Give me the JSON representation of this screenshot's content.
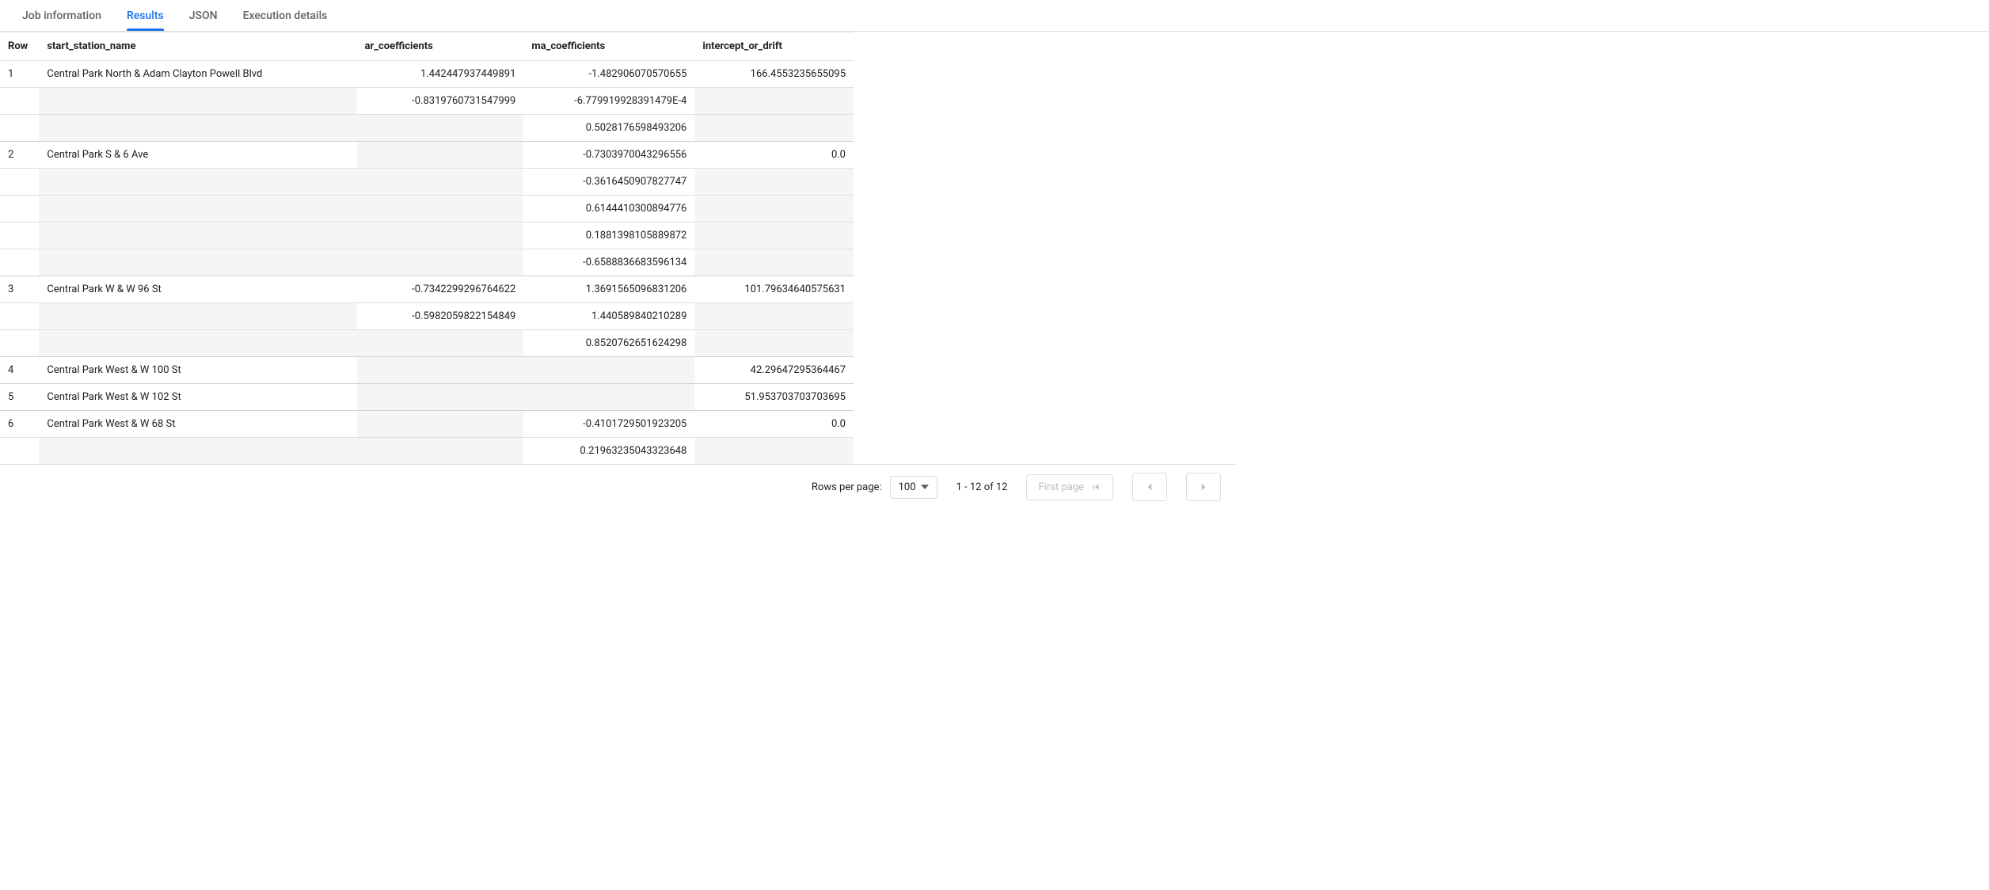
{
  "tabs": {
    "items": [
      {
        "label": "Job information",
        "active": false
      },
      {
        "label": "Results",
        "active": true
      },
      {
        "label": "JSON",
        "active": false
      },
      {
        "label": "Execution details",
        "active": false
      }
    ]
  },
  "table": {
    "headers": {
      "row": "Row",
      "name": "start_station_name",
      "ar": "ar_coefficients",
      "ma": "ma_coefficients",
      "intercept": "intercept_or_drift"
    },
    "groups": [
      {
        "row": "1",
        "name": "Central Park North & Adam Clayton Powell Blvd",
        "intercept": "166.4553235655095",
        "ar": [
          "1.442447937449891",
          "-0.8319760731547999"
        ],
        "ma": [
          "-1.482906070570655",
          "-6.779919928391479E-4",
          "0.5028176598493206"
        ]
      },
      {
        "row": "2",
        "name": "Central Park S & 6 Ave",
        "intercept": "0.0",
        "ar": [],
        "ma": [
          "-0.7303970043296556",
          "-0.3616450907827747",
          "0.6144410300894776",
          "0.1881398105889872",
          "-0.6588836683596134"
        ]
      },
      {
        "row": "3",
        "name": "Central Park W & W 96 St",
        "intercept": "101.79634640575631",
        "ar": [
          "-0.7342299296764622",
          "-0.5982059822154849"
        ],
        "ma": [
          "1.3691565096831206",
          "1.440589840210289",
          "0.8520762651624298"
        ]
      },
      {
        "row": "4",
        "name": "Central Park West & W 100 St",
        "intercept": "42.29647295364467",
        "ar": [],
        "ma": []
      },
      {
        "row": "5",
        "name": "Central Park West & W 102 St",
        "intercept": "51.953703703703695",
        "ar": [],
        "ma": []
      },
      {
        "row": "6",
        "name": "Central Park West & W 68 St",
        "intercept": "0.0",
        "ar": [],
        "ma": [
          "-0.4101729501923205",
          "0.21963235043323648"
        ]
      }
    ]
  },
  "footer": {
    "rows_per_page_label": "Rows per page:",
    "rows_per_page_value": "100",
    "range_text": "1 - 12 of 12",
    "first_page_label": "First page"
  }
}
